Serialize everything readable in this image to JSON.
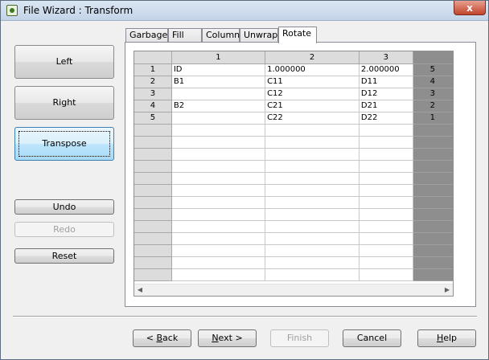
{
  "window": {
    "title": "File Wizard : Transform",
    "close_glyph": "x"
  },
  "left_buttons": {
    "left": "Left",
    "right": "Right",
    "transpose": "Transpose",
    "undo": "Undo",
    "redo": "Redo",
    "reset": "Reset"
  },
  "tabs": [
    "Garbage",
    "Fill",
    "Column",
    "Unwrap",
    "Rotate"
  ],
  "selected_tab": "Rotate",
  "grid": {
    "col_headers": [
      "1",
      "2",
      "3",
      ""
    ],
    "rows": [
      {
        "num": "1",
        "cells": [
          "ID",
          "1.000000",
          "2.000000",
          "5"
        ]
      },
      {
        "num": "2",
        "cells": [
          "B1",
          "C11",
          "D11",
          "4"
        ]
      },
      {
        "num": "3",
        "cells": [
          "",
          "C12",
          "D12",
          "3"
        ]
      },
      {
        "num": "4",
        "cells": [
          "B2",
          "C21",
          "D21",
          "2"
        ]
      },
      {
        "num": "5",
        "cells": [
          "",
          "C22",
          "D22",
          "1"
        ]
      }
    ],
    "empty_rows": 13
  },
  "footer": {
    "back": {
      "prefix": "< ",
      "accel": "B",
      "rest": "ack"
    },
    "next": {
      "accel": "N",
      "rest": "ext >"
    },
    "finish": "Finish",
    "cancel": "Cancel",
    "help": {
      "accel": "H",
      "rest": "elp"
    }
  }
}
